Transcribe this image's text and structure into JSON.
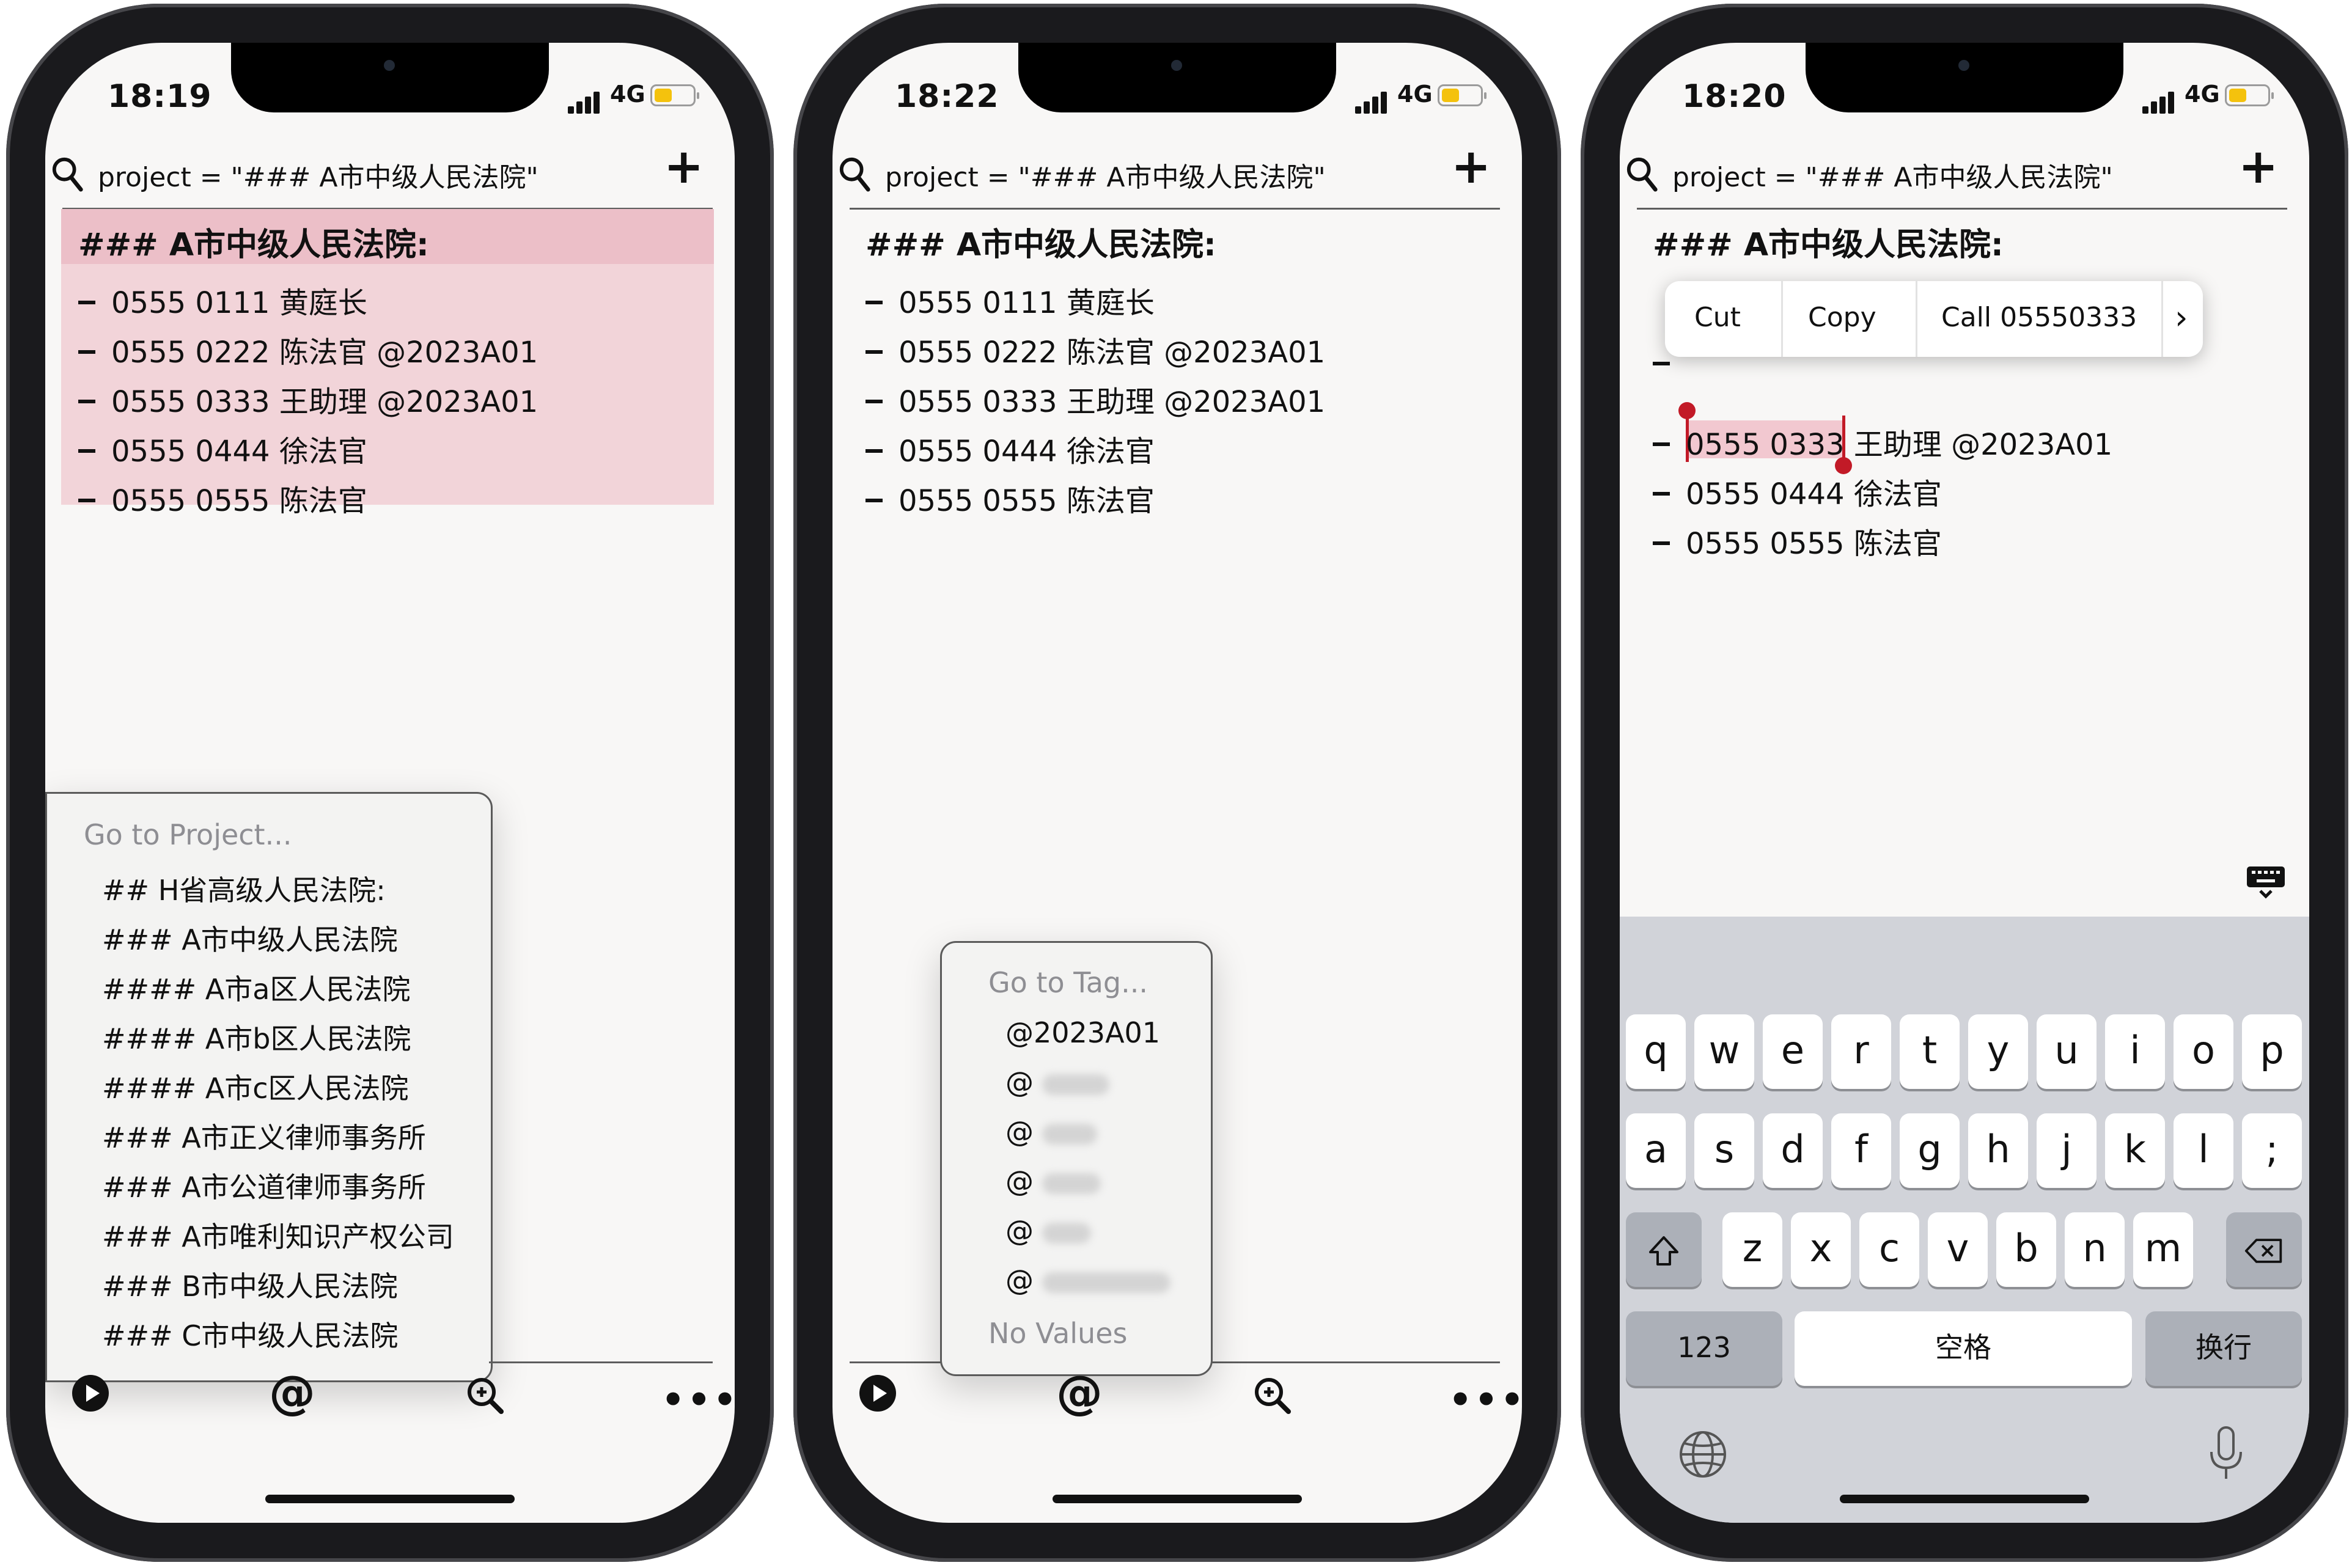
{
  "colors": {
    "highlight": "#f2d4d9",
    "highlight_strong": "#ecbfc8",
    "selection": "#c21a27",
    "battery": "#f4c20d"
  },
  "phones": [
    {
      "time": "18:19",
      "network": "4G",
      "query": "project = \"### A市中级人民法院\"",
      "heading": "### A市中级人民法院:",
      "items": [
        "0555 0111 黄庭长",
        "0555 0222 陈法官 @2023A01",
        "0555 0333 王助理 @2023A01",
        "0555 0444 徐法官",
        "0555 0555 陈法官"
      ],
      "popup": {
        "placeholder": "Go to Project...",
        "options": [
          "## H省高级人民法院:",
          "### A市中级人民法院",
          "#### A市a区人民法院",
          "#### A市b区人民法院",
          "#### A市c区人民法院",
          "### A市正义律师事务所",
          "### A市公道律师事务所",
          "### A市唯利知识产权公司",
          "### B市中级人民法院",
          "### C市中级人民法院"
        ]
      },
      "toolbar": {
        "play": "play-icon",
        "at": "@",
        "zoom": "zoom-icon",
        "more": "•••"
      }
    },
    {
      "time": "18:22",
      "network": "4G",
      "query": "project = \"### A市中级人民法院\"",
      "heading": "### A市中级人民法院:",
      "items": [
        "0555 0111 黄庭长",
        "0555 0222 陈法官 @2023A01",
        "0555 0333 王助理 @2023A01",
        "0555 0444 徐法官",
        "0555 0555 陈法官"
      ],
      "popup": {
        "placeholder": "Go to Tag...",
        "options": [
          "@2023A01",
          "@",
          "@",
          "@",
          "@",
          "@"
        ],
        "footer": "No Values"
      },
      "toolbar": {
        "play": "play-icon",
        "at": "@",
        "zoom": "zoom-icon",
        "more": "•••"
      }
    },
    {
      "time": "18:20",
      "network": "4G",
      "query": "project = \"### A市中级人民法院\"",
      "heading": "### A市中级人民法院:",
      "items": [
        "0555 0333",
        "王助理 @2023A01",
        "0555 0444 徐法官",
        "0555 0555 陈法官"
      ],
      "context_menu": [
        "Cut",
        "Copy",
        "Call 05550333",
        "›"
      ],
      "keyboard": {
        "row1": [
          "q",
          "w",
          "e",
          "r",
          "t",
          "y",
          "u",
          "i",
          "o",
          "p"
        ],
        "row2": [
          "a",
          "s",
          "d",
          "f",
          "g",
          "h",
          "j",
          "k",
          "l",
          ";"
        ],
        "row3": [
          "z",
          "x",
          "c",
          "v",
          "b",
          "n",
          "m"
        ],
        "numbers": "123",
        "space": "空格",
        "return": "换行"
      }
    }
  ]
}
